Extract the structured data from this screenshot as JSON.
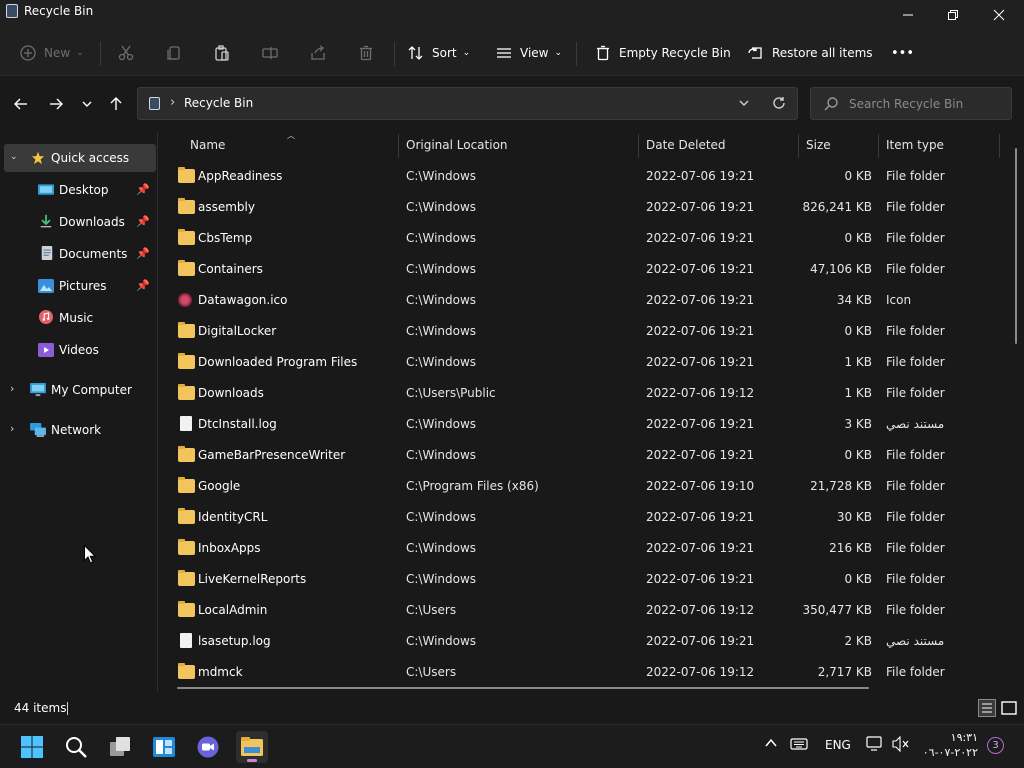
{
  "window": {
    "title": "Recycle Bin"
  },
  "toolbar": {
    "new_label": "New",
    "sort_label": "Sort",
    "view_label": "View",
    "empty_label": "Empty Recycle Bin",
    "restore_label": "Restore all items",
    "more_label": "•••"
  },
  "address": {
    "crumb": "Recycle Bin",
    "search_placeholder": "Search Recycle Bin"
  },
  "nav": {
    "quick_access": "Quick access",
    "items": [
      {
        "label": "Desktop",
        "icon": "desktop-icon",
        "pinned": true
      },
      {
        "label": "Downloads",
        "icon": "downloads-icon",
        "pinned": true
      },
      {
        "label": "Documents",
        "icon": "documents-icon",
        "pinned": true
      },
      {
        "label": "Pictures",
        "icon": "pictures-icon",
        "pinned": true
      },
      {
        "label": "Music",
        "icon": "music-icon",
        "pinned": false
      },
      {
        "label": "Videos",
        "icon": "videos-icon",
        "pinned": false
      }
    ],
    "my_computer": "My Computer",
    "network": "Network"
  },
  "columns": {
    "name": "Name",
    "location": "Original Location",
    "date": "Date Deleted",
    "size": "Size",
    "type": "Item type"
  },
  "files": [
    {
      "name": "AppReadiness",
      "location": "C:\\Windows",
      "date": "2022-07-06 19:21",
      "size": "0 KB",
      "type": "File folder",
      "icon": "folder"
    },
    {
      "name": "assembly",
      "location": "C:\\Windows",
      "date": "2022-07-06 19:21",
      "size": "826,241 KB",
      "type": "File folder",
      "icon": "folder"
    },
    {
      "name": "CbsTemp",
      "location": "C:\\Windows",
      "date": "2022-07-06 19:21",
      "size": "0 KB",
      "type": "File folder",
      "icon": "folder"
    },
    {
      "name": "Containers",
      "location": "C:\\Windows",
      "date": "2022-07-06 19:21",
      "size": "47,106 KB",
      "type": "File folder",
      "icon": "folder"
    },
    {
      "name": "Datawagon.ico",
      "location": "C:\\Windows",
      "date": "2022-07-06 19:21",
      "size": "34 KB",
      "type": "Icon",
      "icon": "ico"
    },
    {
      "name": "DigitalLocker",
      "location": "C:\\Windows",
      "date": "2022-07-06 19:21",
      "size": "0 KB",
      "type": "File folder",
      "icon": "folder"
    },
    {
      "name": "Downloaded Program Files",
      "location": "C:\\Windows",
      "date": "2022-07-06 19:21",
      "size": "1 KB",
      "type": "File folder",
      "icon": "folder"
    },
    {
      "name": "Downloads",
      "location": "C:\\Users\\Public",
      "date": "2022-07-06 19:12",
      "size": "1 KB",
      "type": "File folder",
      "icon": "folder"
    },
    {
      "name": "DtcInstall.log",
      "location": "C:\\Windows",
      "date": "2022-07-06 19:21",
      "size": "3 KB",
      "type": "مستند نصي",
      "icon": "file"
    },
    {
      "name": "GameBarPresenceWriter",
      "location": "C:\\Windows",
      "date": "2022-07-06 19:21",
      "size": "0 KB",
      "type": "File folder",
      "icon": "folder"
    },
    {
      "name": "Google",
      "location": "C:\\Program Files (x86)",
      "date": "2022-07-06 19:10",
      "size": "21,728 KB",
      "type": "File folder",
      "icon": "folder"
    },
    {
      "name": "IdentityCRL",
      "location": "C:\\Windows",
      "date": "2022-07-06 19:21",
      "size": "30 KB",
      "type": "File folder",
      "icon": "folder"
    },
    {
      "name": "InboxApps",
      "location": "C:\\Windows",
      "date": "2022-07-06 19:21",
      "size": "216 KB",
      "type": "File folder",
      "icon": "folder"
    },
    {
      "name": "LiveKernelReports",
      "location": "C:\\Windows",
      "date": "2022-07-06 19:21",
      "size": "0 KB",
      "type": "File folder",
      "icon": "folder"
    },
    {
      "name": "LocalAdmin",
      "location": "C:\\Users",
      "date": "2022-07-06 19:12",
      "size": "350,477 KB",
      "type": "File folder",
      "icon": "folder"
    },
    {
      "name": "lsasetup.log",
      "location": "C:\\Windows",
      "date": "2022-07-06 19:21",
      "size": "2 KB",
      "type": "مستند نصي",
      "icon": "file"
    },
    {
      "name": "mdmck",
      "location": "C:\\Users",
      "date": "2022-07-06 19:12",
      "size": "2,717 KB",
      "type": "File folder",
      "icon": "folder"
    }
  ],
  "status": {
    "count": "44 items"
  },
  "taskbar": {
    "language": "ENG",
    "time": "١٩:٣١",
    "date": "٢٠٢٢-٠٧-٠٦",
    "notifications": "3"
  },
  "colors": {
    "folder": "#f2c55c",
    "background": "#191919",
    "accent": "#c987d6"
  }
}
